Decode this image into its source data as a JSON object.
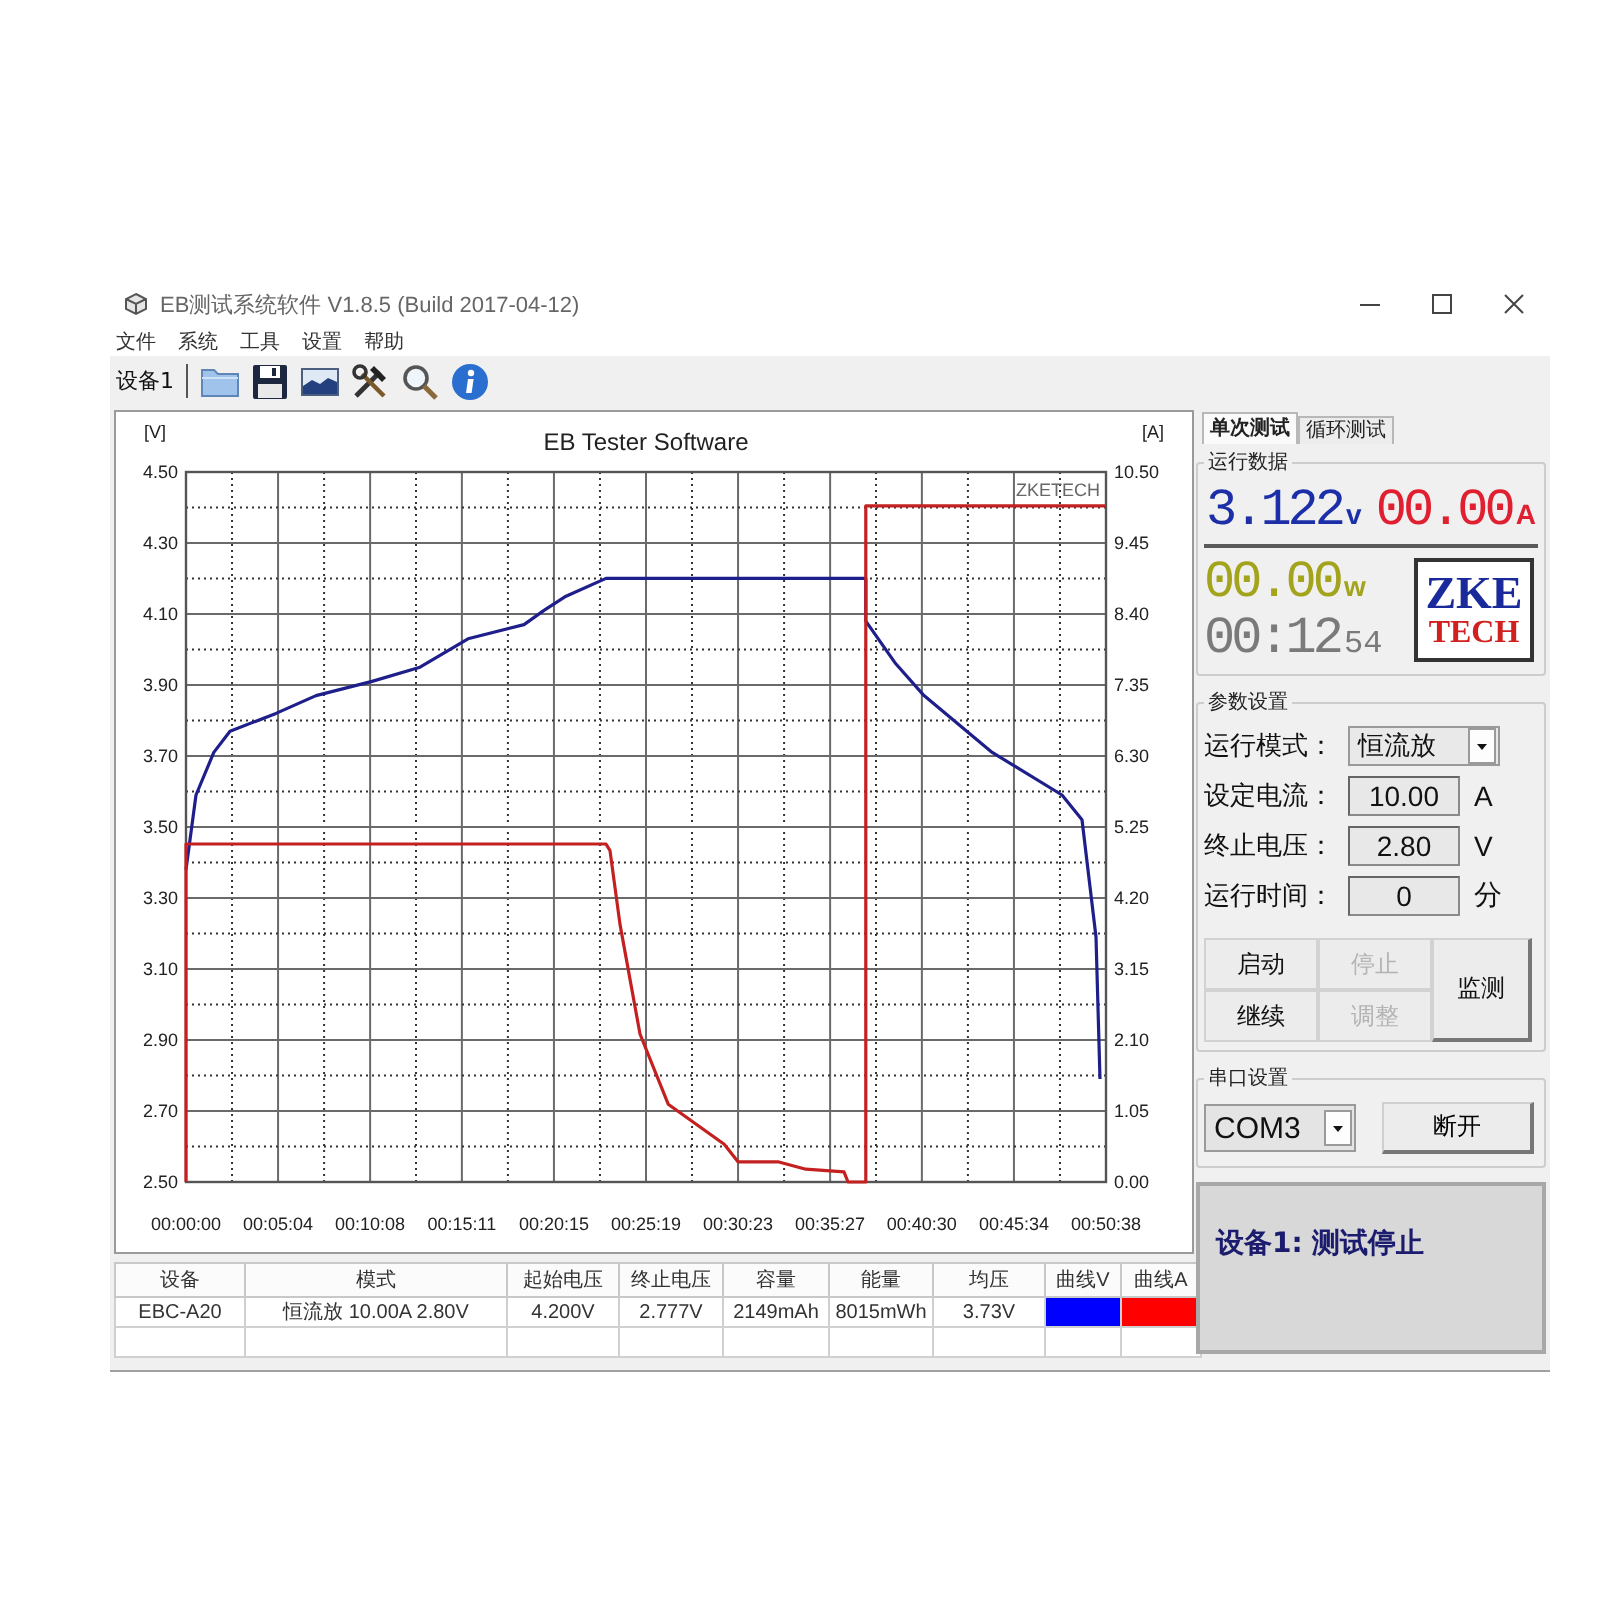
{
  "window": {
    "title": "EB测试系统软件 V1.8.5 (Build 2017-04-12)"
  },
  "menu": [
    "文件",
    "系统",
    "工具",
    "设置",
    "帮助"
  ],
  "toolbar": {
    "device_label": "设备1"
  },
  "chart": {
    "chart_data": {
      "type": "line",
      "title": "EB Tester Software",
      "ylabel": "[V]",
      "y2label": "[A]",
      "grid": true,
      "xlim": [
        0,
        3038
      ],
      "ylim": [
        2.5,
        4.5
      ],
      "y2lim": [
        0,
        10.5
      ],
      "x": [
        0,
        0,
        33,
        92,
        145,
        297,
        429,
        614,
        773,
        931,
        1116,
        1182,
        1255,
        1387,
        1400,
        1433,
        1499,
        1592,
        1777,
        1823,
        1955,
        2047,
        2173,
        2186,
        2245,
        2245,
        2344,
        2437,
        2662,
        2893,
        2959,
        3005,
        3018,
        3038
      ],
      "series": [
        {
          "color": "#1f1f8c",
          "values": [
            3.38,
            3.38,
            3.59,
            3.71,
            3.77,
            3.82,
            3.87,
            3.91,
            3.95,
            4.03,
            4.07,
            4.11,
            4.15,
            4.2,
            4.2,
            4.2,
            4.2,
            4.2,
            4.2,
            4.2,
            4.2,
            4.2,
            4.2,
            4.2,
            4.2,
            4.08,
            3.96,
            3.87,
            3.71,
            3.59,
            3.52,
            3.19,
            2.79,
            null
          ]
        },
        {
          "color": "#c42020",
          "axis": "y2",
          "values": [
            0,
            5,
            5,
            5,
            5,
            5,
            5,
            5,
            5,
            5,
            5,
            5,
            5,
            5,
            4.9,
            3.81,
            2.19,
            1.15,
            0.56,
            0.3,
            0.3,
            0.19,
            0.15,
            0,
            0,
            10,
            10,
            10,
            10,
            10,
            10,
            10,
            10,
            10
          ]
        }
      ],
      "xticks": [
        {
          "value": 0,
          "label": "00:00:00"
        },
        {
          "value": 304,
          "label": "00:05:04"
        },
        {
          "value": 608,
          "label": "00:10:08"
        },
        {
          "value": 911,
          "label": "00:15:11"
        },
        {
          "value": 1215,
          "label": "00:20:15"
        },
        {
          "value": 1519,
          "label": "00:25:19"
        },
        {
          "value": 1823,
          "label": "00:30:23"
        },
        {
          "value": 2127,
          "label": "00:35:27"
        },
        {
          "value": 2430,
          "label": "00:40:30"
        },
        {
          "value": 2734,
          "label": "00:45:34"
        },
        {
          "value": 3038,
          "label": "00:50:38"
        }
      ],
      "yticks": [
        {
          "value": 2.5,
          "label": "2.50"
        },
        {
          "value": 2.7,
          "label": "2.70"
        },
        {
          "value": 2.9,
          "label": "2.90"
        },
        {
          "value": 3.1,
          "label": "3.10"
        },
        {
          "value": 3.3,
          "label": "3.30"
        },
        {
          "value": 3.5,
          "label": "3.50"
        },
        {
          "value": 3.7,
          "label": "3.70"
        },
        {
          "value": 3.9,
          "label": "3.90"
        },
        {
          "value": 4.1,
          "label": "4.10"
        },
        {
          "value": 4.3,
          "label": "4.30"
        },
        {
          "value": 4.5,
          "label": "4.50"
        }
      ],
      "y2ticks": [
        {
          "value": 0,
          "label": "0.00"
        },
        {
          "value": 1.05,
          "label": "1.05"
        },
        {
          "value": 2.1,
          "label": "2.10"
        },
        {
          "value": 3.15,
          "label": "3.15"
        },
        {
          "value": 4.2,
          "label": "4.20"
        },
        {
          "value": 5.25,
          "label": "5.25"
        },
        {
          "value": 6.3,
          "label": "6.30"
        },
        {
          "value": 7.35,
          "label": "7.35"
        },
        {
          "value": 8.4,
          "label": "8.40"
        },
        {
          "value": 9.45,
          "label": "9.45"
        },
        {
          "value": 10.5,
          "label": "10.50"
        }
      ],
      "annotations": [
        {
          "text": "ZKETECH"
        }
      ]
    }
  },
  "table": {
    "columns": [
      "设备",
      "模式",
      "起始电压",
      "终止电压",
      "容量",
      "能量",
      "均压",
      "曲线V",
      "曲线A"
    ],
    "rows": [
      {
        "cells": [
          "EBC-A20",
          "恒流放 10.00A 2.80V",
          "4.200V",
          "2.777V",
          "2149mAh",
          "8015mWh",
          "3.73V"
        ],
        "curves": [
          {
            "color": "#0000ff"
          },
          {
            "color": "#ff0000"
          }
        ]
      }
    ]
  },
  "side_panel": {
    "tabs": [
      {
        "label": "单次测试",
        "selected": true
      },
      {
        "label": "循环测试",
        "selected": false
      }
    ],
    "run_data": {
      "title": "运行数据",
      "voltage": {
        "value": "3.122",
        "unit": "v"
      },
      "current": {
        "value": "00.00",
        "unit": "A"
      },
      "power": {
        "value": "00.00",
        "unit": "w"
      },
      "time": {
        "value": "00:12",
        "seconds": "54"
      },
      "logo": {
        "top": "ZKE",
        "bottom": "TECH"
      }
    },
    "params": {
      "title": "参数设置",
      "rows": [
        {
          "kind": "dropdown",
          "label": "运行模式：",
          "value": "恒流放"
        },
        {
          "kind": "field",
          "label": "设定电流：",
          "value": "10.00",
          "unit": "A"
        },
        {
          "kind": "field",
          "label": "终止电压：",
          "value": "2.80",
          "unit": "V"
        },
        {
          "kind": "field",
          "label": "运行时间：",
          "value": "0",
          "unit": "分"
        }
      ],
      "buttons": [
        {
          "kind": "half",
          "label": "启动",
          "disabled": false
        },
        {
          "kind": "half",
          "label": "停止",
          "disabled": true
        },
        {
          "kind": "tall",
          "label": "监测",
          "disabled": false
        },
        {
          "kind": "half",
          "label": "继续",
          "disabled": false
        },
        {
          "kind": "half",
          "label": "调整",
          "disabled": true
        }
      ]
    },
    "serial": {
      "title": "串口设置",
      "port": "COM3",
      "button": "断开"
    },
    "status": "设备1: 测试停止"
  }
}
